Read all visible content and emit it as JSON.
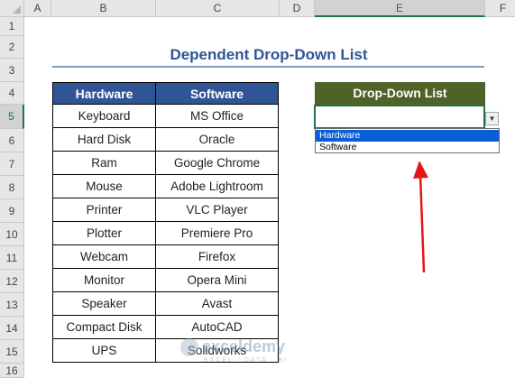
{
  "sheet": {
    "columns": [
      "A",
      "B",
      "C",
      "D",
      "E",
      "F"
    ],
    "rows": [
      "1",
      "2",
      "3",
      "4",
      "5",
      "6",
      "7",
      "8",
      "9",
      "10",
      "11",
      "12",
      "13",
      "14",
      "15",
      "16"
    ],
    "selected_column": "E",
    "selected_row": "5"
  },
  "title": "Dependent Drop-Down List",
  "table": {
    "headers": [
      "Hardware",
      "Software"
    ],
    "rows": [
      [
        "Keyboard",
        "MS Office"
      ],
      [
        "Hard Disk",
        "Oracle"
      ],
      [
        "Ram",
        "Google Chrome"
      ],
      [
        "Mouse",
        "Adobe Lightroom"
      ],
      [
        "Printer",
        "VLC Player"
      ],
      [
        "Plotter",
        "Premiere Pro"
      ],
      [
        "Webcam",
        "Firefox"
      ],
      [
        "Monitor",
        "Opera Mini"
      ],
      [
        "Speaker",
        "Avast"
      ],
      [
        "Compact Disk",
        "AutoCAD"
      ],
      [
        "UPS",
        "Solidworks"
      ]
    ]
  },
  "dropdown": {
    "header": "Drop-Down List",
    "value": "",
    "options": [
      "Hardware",
      "Software"
    ],
    "highlighted_index": 0
  },
  "annotation": {
    "arrow_color": "#e8141c"
  },
  "watermark": {
    "name": "exceldemy",
    "tagline": "EXCEL · DATA · BI"
  }
}
